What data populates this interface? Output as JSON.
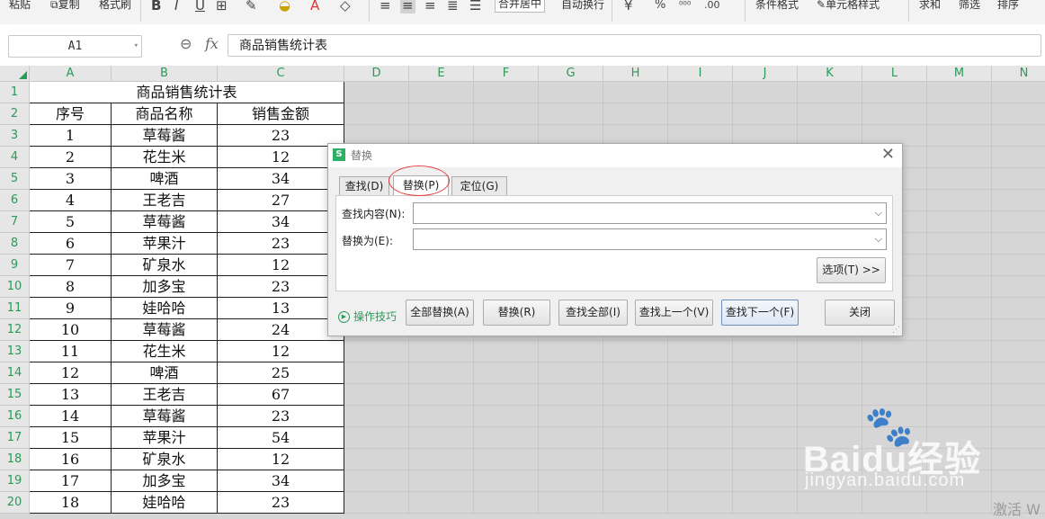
{
  "ribbon": {
    "paste": "粘贴",
    "copy": "复制",
    "format_painter": "格式刷",
    "merge_center": "合并居中",
    "wrap_text": "自动换行",
    "currency": "¥",
    "percent": "%",
    "conditional_format": "条件格式",
    "cell_style": "单元格样式",
    "sum": "求和",
    "filter": "筛选",
    "sort": "排序"
  },
  "formula_bar": {
    "cell_ref": "A1",
    "fx": "fx",
    "content": "商品销售统计表"
  },
  "columns": [
    "A",
    "B",
    "C",
    "D",
    "E",
    "F",
    "G",
    "H",
    "I",
    "J",
    "K",
    "L",
    "M",
    "N"
  ],
  "rows": [
    "1",
    "2",
    "3",
    "4",
    "5",
    "6",
    "7",
    "8",
    "9",
    "10",
    "11",
    "12",
    "13",
    "14",
    "15",
    "16",
    "17",
    "18",
    "19",
    "20"
  ],
  "sheet": {
    "title": "商品销售统计表",
    "headers": [
      "序号",
      "商品名称",
      "销售金额"
    ],
    "data": [
      [
        "1",
        "草莓酱",
        "23"
      ],
      [
        "2",
        "花生米",
        "12"
      ],
      [
        "3",
        "啤酒",
        "34"
      ],
      [
        "4",
        "王老吉",
        "27"
      ],
      [
        "5",
        "草莓酱",
        "34"
      ],
      [
        "6",
        "苹果汁",
        "23"
      ],
      [
        "7",
        "矿泉水",
        "12"
      ],
      [
        "8",
        "加多宝",
        "23"
      ],
      [
        "9",
        "娃哈哈",
        "13"
      ],
      [
        "10",
        "草莓酱",
        "24"
      ],
      [
        "11",
        "花生米",
        "12"
      ],
      [
        "12",
        "啤酒",
        "25"
      ],
      [
        "13",
        "王老吉",
        "67"
      ],
      [
        "14",
        "草莓酱",
        "23"
      ],
      [
        "15",
        "苹果汁",
        "54"
      ],
      [
        "16",
        "矿泉水",
        "12"
      ],
      [
        "17",
        "加多宝",
        "34"
      ],
      [
        "18",
        "娃哈哈",
        "23"
      ]
    ]
  },
  "dialog": {
    "title": "替换",
    "logo": "S",
    "close": "✕",
    "tabs": [
      "查找(D)",
      "替换(P)",
      "定位(G)"
    ],
    "find_label": "查找内容(N):",
    "find_value": "",
    "replace_label": "替换为(E):",
    "replace_value": "",
    "options_button": "选项(T) >>",
    "tips_link": "操作技巧",
    "buttons": {
      "replace_all": "全部替换(A)",
      "replace": "替换(R)",
      "find_all": "查找全部(I)",
      "find_prev": "查找上一个(V)",
      "find_next": "查找下一个(F)",
      "close": "关闭"
    }
  },
  "watermark": {
    "brand": "Baidu经验",
    "url": "jingyan.baidu.com"
  },
  "activate_text": "激活 W"
}
